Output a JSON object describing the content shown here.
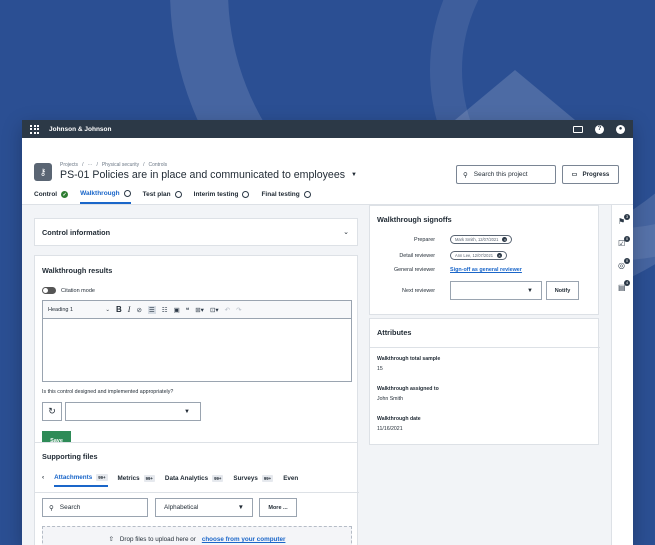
{
  "topbar": {
    "org_name": "Johnson & Johnson"
  },
  "header": {
    "breadcrumb": [
      "Projects",
      "/",
      "···",
      "/",
      "Physical security",
      "/",
      "Controls"
    ],
    "title": "PS-01 Policies are in place and communicated to employees",
    "search_label": "Search this project",
    "progress_label": "Progress"
  },
  "tabs": [
    {
      "label": "Control",
      "status": "complete"
    },
    {
      "label": "Walkthrough",
      "status": "active"
    },
    {
      "label": "Test plan",
      "status": "open"
    },
    {
      "label": "Interim testing",
      "status": "open"
    },
    {
      "label": "Final testing",
      "status": "open"
    }
  ],
  "control_info": {
    "title": "Control information"
  },
  "walkthrough_results": {
    "title": "Walkthrough results",
    "citation_label": "Citation mode",
    "heading_select": "Heading 1",
    "question": "Is this control designed and implemented appropriately?",
    "save_label": "Save"
  },
  "supporting_files": {
    "title": "Supporting files",
    "tabs": [
      {
        "label": "Attachments",
        "badge": "99+"
      },
      {
        "label": "Metrics",
        "badge": "99+"
      },
      {
        "label": "Data Analytics",
        "badge": "99+"
      },
      {
        "label": "Surveys",
        "badge": "99+"
      },
      {
        "label": "Even",
        "badge": ""
      }
    ],
    "search_placeholder": "Search",
    "sort_value": "Alphabetical",
    "more_label": "More ...",
    "drop_text": "Drop files to upload here or",
    "drop_link": "choose from your computer"
  },
  "signoffs": {
    "title": "Walkthrough signoffs",
    "preparer_label": "Preparer",
    "preparer_value": "Mark Smith, 12/07/2021",
    "detail_label": "Detail reviewer",
    "detail_value": "Ann Lee, 12/07/2021",
    "general_label": "General reviewer",
    "general_link": "Sign-off as general reviewer",
    "next_label": "Next reviewer",
    "notify_label": "Notify"
  },
  "attributes": {
    "title": "Attributes",
    "items": [
      {
        "key": "Walkthrough total sample",
        "value": "15"
      },
      {
        "key": "Walkthrough assigned to",
        "value": "John Smith"
      },
      {
        "key": "Walkthrough date",
        "value": "11/16/2021"
      }
    ]
  },
  "rail_badges": [
    "3",
    "0",
    "0",
    "4"
  ],
  "colors": {
    "accent": "#1a66c9",
    "save": "#2e8b57",
    "topbar": "#2c3947",
    "background": "#2b4f93"
  }
}
